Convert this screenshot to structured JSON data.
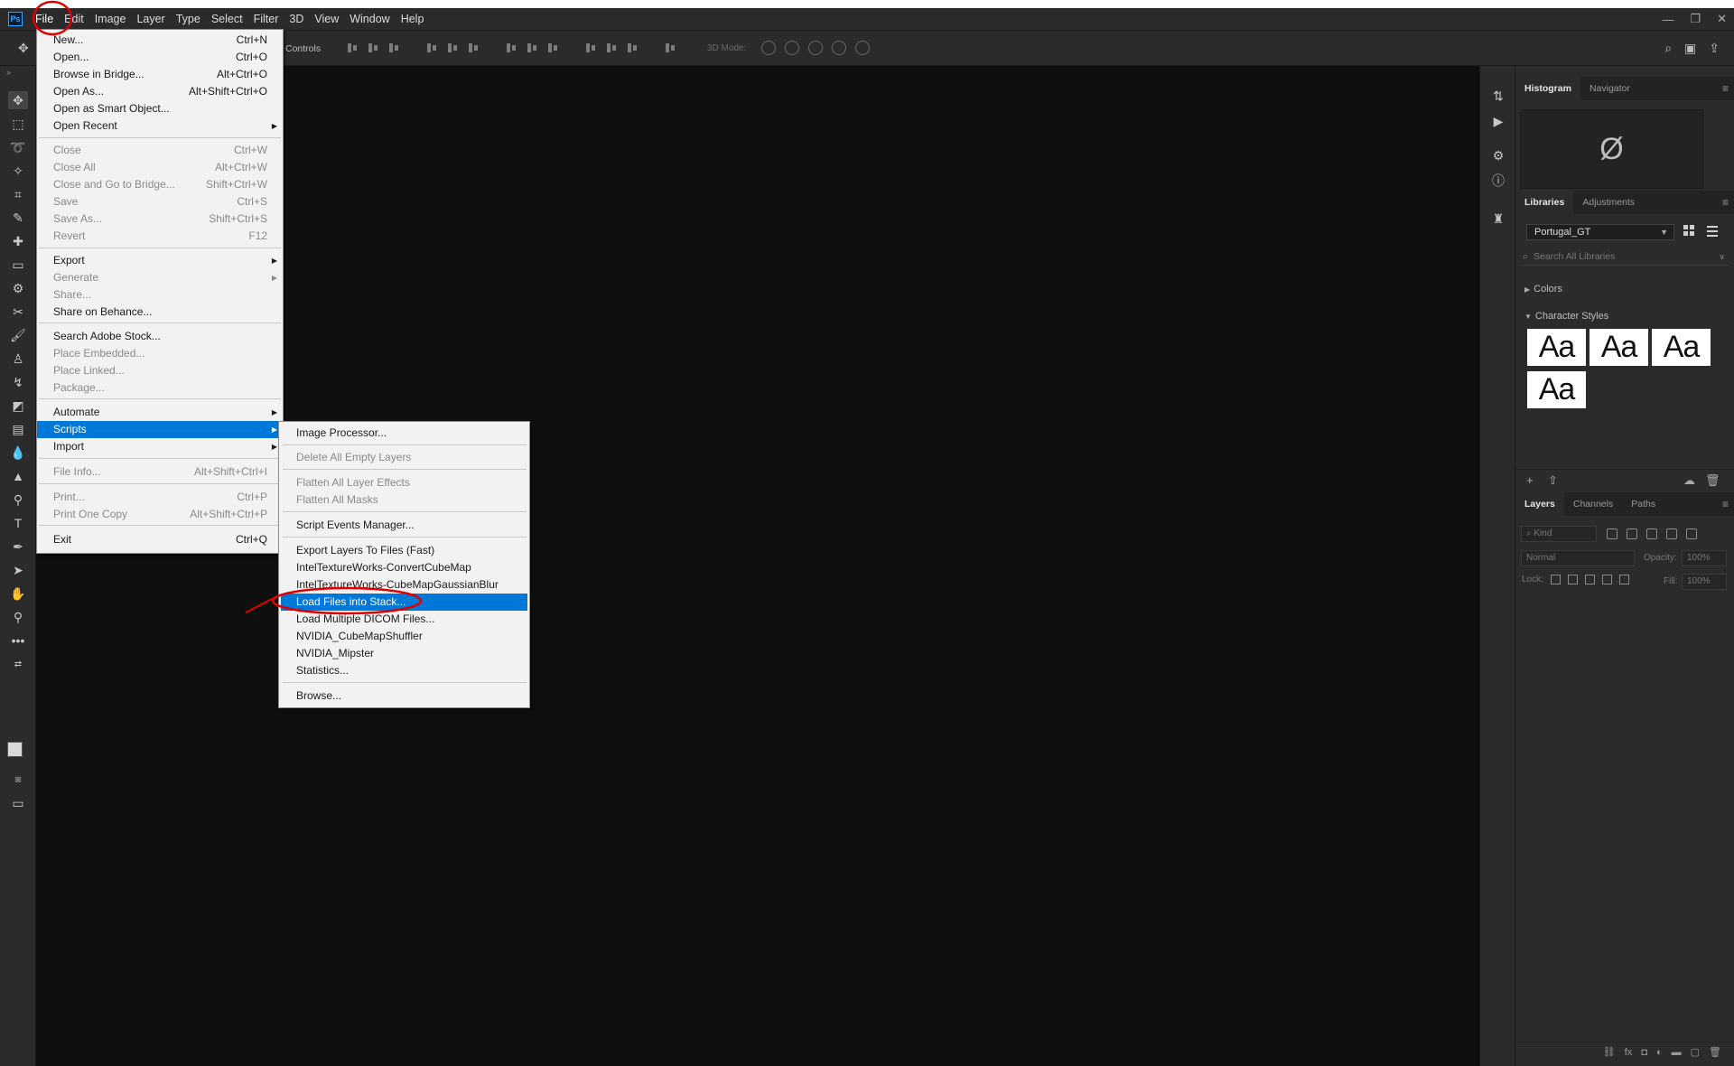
{
  "app": {
    "logo": "Ps",
    "menubar": [
      "File",
      "Edit",
      "Image",
      "Layer",
      "Type",
      "Select",
      "Filter",
      "3D",
      "View",
      "Window",
      "Help"
    ]
  },
  "window_controls": [
    "—",
    "❐",
    "✕"
  ],
  "options_bar": {
    "controls_label": "Controls",
    "mode_3d_label": "3D Mode:"
  },
  "file_menu": {
    "items": [
      {
        "label": "New...",
        "shortcut": "Ctrl+N",
        "disabled": false,
        "submenu": false
      },
      {
        "label": "Open...",
        "shortcut": "Ctrl+O",
        "disabled": false,
        "submenu": false
      },
      {
        "label": "Browse in Bridge...",
        "shortcut": "Alt+Ctrl+O",
        "disabled": false,
        "submenu": false
      },
      {
        "label": "Open As...",
        "shortcut": "Alt+Shift+Ctrl+O",
        "disabled": false,
        "submenu": false
      },
      {
        "label": "Open as Smart Object...",
        "shortcut": "",
        "disabled": false,
        "submenu": false
      },
      {
        "label": "Open Recent",
        "shortcut": "",
        "disabled": false,
        "submenu": true
      },
      {
        "label": "Close",
        "shortcut": "Ctrl+W",
        "disabled": true,
        "submenu": false
      },
      {
        "label": "Close All",
        "shortcut": "Alt+Ctrl+W",
        "disabled": true,
        "submenu": false
      },
      {
        "label": "Close and Go to Bridge...",
        "shortcut": "Shift+Ctrl+W",
        "disabled": true,
        "submenu": false
      },
      {
        "label": "Save",
        "shortcut": "Ctrl+S",
        "disabled": true,
        "submenu": false
      },
      {
        "label": "Save As...",
        "shortcut": "Shift+Ctrl+S",
        "disabled": true,
        "submenu": false
      },
      {
        "label": "Revert",
        "shortcut": "F12",
        "disabled": true,
        "submenu": false
      },
      {
        "label": "Export",
        "shortcut": "",
        "disabled": false,
        "submenu": true
      },
      {
        "label": "Generate",
        "shortcut": "",
        "disabled": true,
        "submenu": true
      },
      {
        "label": "Share...",
        "shortcut": "",
        "disabled": true,
        "submenu": false
      },
      {
        "label": "Share on Behance...",
        "shortcut": "",
        "disabled": false,
        "submenu": false
      },
      {
        "label": "Search Adobe Stock...",
        "shortcut": "",
        "disabled": false,
        "submenu": false
      },
      {
        "label": "Place Embedded...",
        "shortcut": "",
        "disabled": true,
        "submenu": false
      },
      {
        "label": "Place Linked...",
        "shortcut": "",
        "disabled": true,
        "submenu": false
      },
      {
        "label": "Package...",
        "shortcut": "",
        "disabled": true,
        "submenu": false
      },
      {
        "label": "Automate",
        "shortcut": "",
        "disabled": false,
        "submenu": true
      },
      {
        "label": "Scripts",
        "shortcut": "",
        "disabled": false,
        "submenu": true,
        "highlighted": true
      },
      {
        "label": "Import",
        "shortcut": "",
        "disabled": false,
        "submenu": true
      },
      {
        "label": "File Info...",
        "shortcut": "Alt+Shift+Ctrl+I",
        "disabled": true,
        "submenu": false
      },
      {
        "label": "Print...",
        "shortcut": "Ctrl+P",
        "disabled": true,
        "submenu": false
      },
      {
        "label": "Print One Copy",
        "shortcut": "Alt+Shift+Ctrl+P",
        "disabled": true,
        "submenu": false
      },
      {
        "label": "Exit",
        "shortcut": "Ctrl+Q",
        "disabled": false,
        "submenu": false
      }
    ]
  },
  "scripts_menu": {
    "items": [
      {
        "label": "Image Processor...",
        "disabled": false
      },
      {
        "label": "Delete All Empty Layers",
        "disabled": true
      },
      {
        "label": "Flatten All Layer Effects",
        "disabled": true
      },
      {
        "label": "Flatten All Masks",
        "disabled": true
      },
      {
        "label": "Script Events Manager...",
        "disabled": false
      },
      {
        "label": "Export Layers To Files (Fast)",
        "disabled": false
      },
      {
        "label": "IntelTextureWorks-ConvertCubeMap",
        "disabled": false
      },
      {
        "label": "IntelTextureWorks-CubeMapGaussianBlur",
        "disabled": false
      },
      {
        "label": "Load Files into Stack...",
        "disabled": false,
        "highlighted": true
      },
      {
        "label": "Load Multiple DICOM Files...",
        "disabled": false
      },
      {
        "label": "NVIDIA_CubeMapShuffler",
        "disabled": false
      },
      {
        "label": "NVIDIA_Mipster",
        "disabled": false
      },
      {
        "label": "Statistics...",
        "disabled": false
      },
      {
        "label": "Browse...",
        "disabled": false
      }
    ]
  },
  "panels": {
    "histogram_tabs": [
      "Histogram",
      "Navigator"
    ],
    "histogram_placeholder": "Ø",
    "libraries_tabs": [
      "Libraries",
      "Adjustments"
    ],
    "library_name": "Portugal_GT",
    "library_search_placeholder": "Search All Libraries",
    "sections": [
      "Colors",
      "Character Styles"
    ],
    "character_style_tiles": [
      "Aa",
      "Aa",
      "Aa",
      "Aa"
    ],
    "layers_tabs": [
      "Layers",
      "Channels",
      "Paths"
    ],
    "kind_filter": "Kind",
    "blend_mode": "Normal",
    "opacity_label": "Opacity:",
    "opacity_value": "100%",
    "lock_label": "Lock:",
    "fill_label": "Fill:",
    "fill_value": "100%"
  },
  "colors": {
    "menubar_bg": "#2b2b2b",
    "canvas_bg": "#0f0f0f",
    "menu_bg": "#f2f2f2",
    "highlight": "#0078d7",
    "annotation": "#e00000"
  }
}
